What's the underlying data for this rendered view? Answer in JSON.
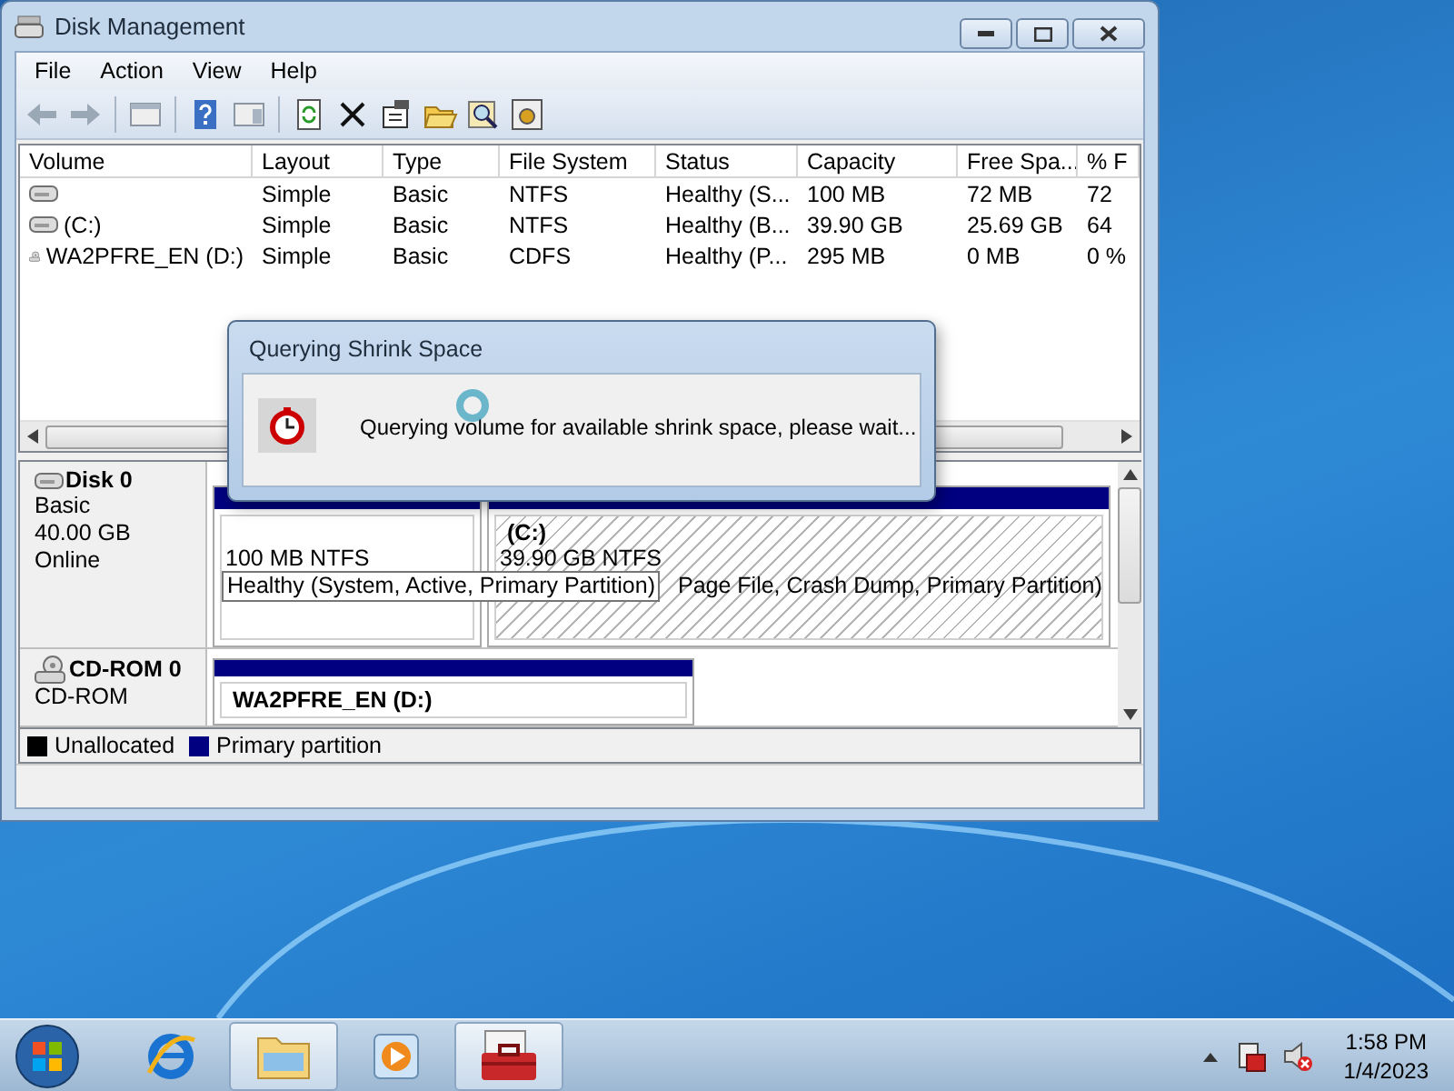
{
  "window": {
    "title": "Disk Management"
  },
  "menu": [
    {
      "label": "File"
    },
    {
      "label": "Action"
    },
    {
      "label": "View"
    },
    {
      "label": "Help"
    }
  ],
  "volumes": {
    "columns": [
      "Volume",
      "Layout",
      "Type",
      "File System",
      "Status",
      "Capacity",
      "Free Spa...",
      "% F"
    ],
    "rows": [
      {
        "kind": "drive",
        "cells": [
          "",
          "Simple",
          "Basic",
          "NTFS",
          "Healthy (S...",
          "100 MB",
          "72 MB",
          "72"
        ]
      },
      {
        "kind": "drive",
        "cells": [
          "(C:)",
          "Simple",
          "Basic",
          "NTFS",
          "Healthy (B...",
          "39.90 GB",
          "25.69 GB",
          "64"
        ]
      },
      {
        "kind": "cdrom",
        "cells": [
          "WA2PFRE_EN (D:)",
          "Simple",
          "Basic",
          "CDFS",
          "Healthy (P...",
          "295 MB",
          "0 MB",
          "0 %"
        ]
      }
    ]
  },
  "disks": [
    {
      "kind": "disk",
      "name": "Disk 0",
      "lines": [
        "Basic",
        "40.00 GB",
        "Online"
      ],
      "partitions": [
        {
          "size": "100 MB NTFS",
          "status": "Healthy (System, Active, Primary Partition)",
          "selected": false,
          "tooltip": true
        },
        {
          "label": "(C:)",
          "size": "39.90 GB NTFS",
          "status": "Page File, Crash Dump, Primary Partition)",
          "selected": true,
          "tooltip": false
        }
      ]
    },
    {
      "kind": "cdrom",
      "name": "CD-ROM 0",
      "lines": [
        "CD-ROM"
      ],
      "partitions": [
        {
          "label": "WA2PFRE_EN  (D:)",
          "selected": false
        }
      ]
    }
  ],
  "legend": [
    {
      "label": "Unallocated",
      "color": "#000000"
    },
    {
      "label": "Primary partition",
      "color": "#000080"
    }
  ],
  "dialog": {
    "title": "Querying Shrink Space",
    "message": "Querying volume for available shrink space, please wait..."
  },
  "taskbar": {
    "items": [
      {
        "kind": "browser",
        "running": false
      },
      {
        "kind": "folder",
        "running": true
      },
      {
        "kind": "media",
        "running": false
      },
      {
        "kind": "toolbox",
        "running": true
      }
    ],
    "time": "1:58 PM",
    "date": "1/4/2023"
  }
}
